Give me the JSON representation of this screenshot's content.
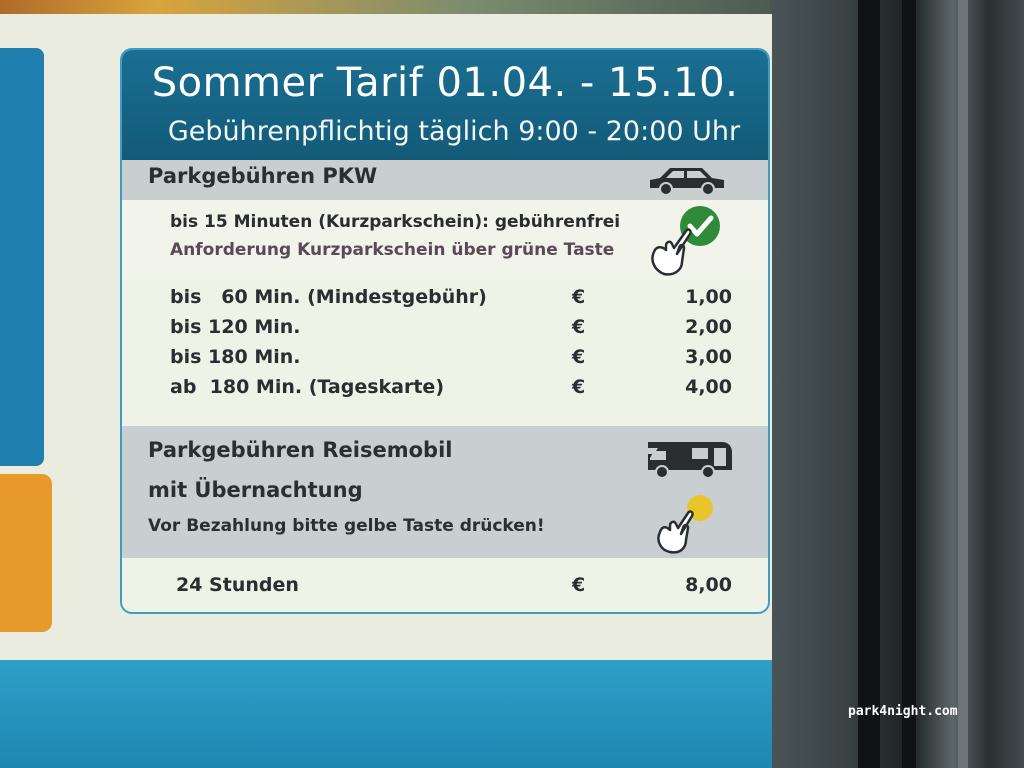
{
  "colors": {
    "header_bg": "#1b6f93",
    "section_bg": "#c9ced0",
    "card_border": "#3f9cc4",
    "check_green": "#2f8a3a",
    "button_yellow": "#e8c52a",
    "side_blue": "#1f7fae",
    "side_orange": "#e79a2b"
  },
  "header": {
    "title": "Sommer Tarif 01.04. - 15.10.",
    "subtitle": "Gebührenpflichtig täglich 9:00 - 20:00 Uhr"
  },
  "pkw": {
    "section_title": "Parkgebühren PKW",
    "icon": "car-icon",
    "short_parking_line": "bis 15 Minuten (Kurzparkschein): gebührenfrei",
    "short_parking_hint": "Anforderung Kurzparkschein über grüne Taste",
    "short_parking_button_icon": "green-check-button-icon",
    "rates": [
      {
        "label": "bis   60 Min. (Mindestgebühr)",
        "currency": "€",
        "amount": "1,00"
      },
      {
        "label": "bis 120 Min.",
        "currency": "€",
        "amount": "2,00"
      },
      {
        "label": "bis 180 Min.",
        "currency": "€",
        "amount": "3,00"
      },
      {
        "label": "ab  180 Min. (Tageskarte)",
        "currency": "€",
        "amount": "4,00"
      }
    ]
  },
  "reisemobil": {
    "section_title_line1": "Parkgebühren Reisemobil",
    "section_title_line2": "mit Übernachtung",
    "hint": "Vor Bezahlung bitte gelbe Taste drücken!",
    "icon": "motorhome-icon",
    "button_icon": "yellow-button-icon",
    "rate": {
      "label": "24 Stunden",
      "currency": "€",
      "amount": "8,00"
    }
  },
  "watermark": "park4night.com"
}
